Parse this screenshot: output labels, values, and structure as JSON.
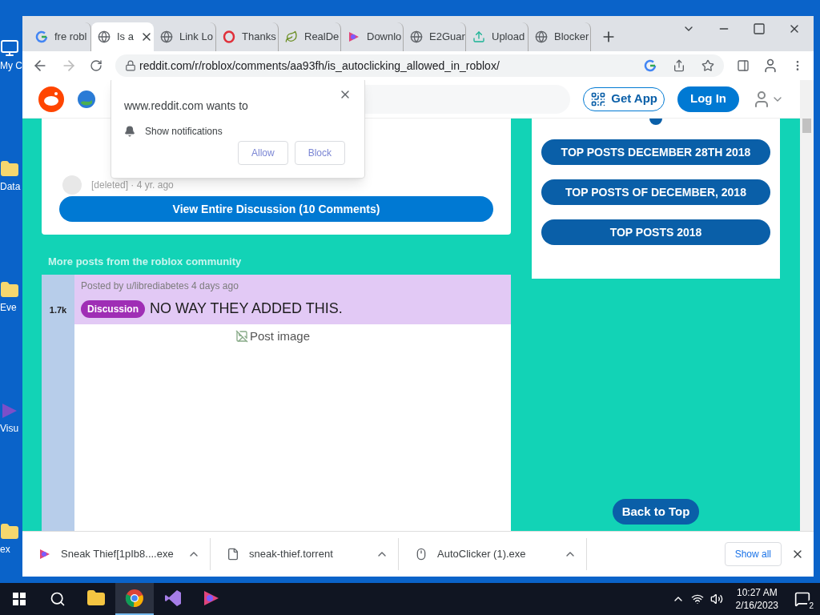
{
  "desktop_icons": [
    {
      "label": "My C",
      "kind": "pc"
    },
    {
      "label": "Data",
      "kind": "folder"
    },
    {
      "label": "Eve",
      "kind": "folder"
    },
    {
      "label": "Visu",
      "kind": "vs"
    },
    {
      "label": "ex",
      "kind": "folder"
    }
  ],
  "tabs": [
    {
      "title": "fre robl",
      "kind": "google",
      "selected": false
    },
    {
      "title": "Is a",
      "kind": "globe",
      "selected": true
    },
    {
      "title": "Link Lo",
      "kind": "globe",
      "selected": false
    },
    {
      "title": "Thanks",
      "kind": "opera",
      "selected": false
    },
    {
      "title": "RealDe",
      "kind": "leaf",
      "selected": false
    },
    {
      "title": "Downlo",
      "kind": "ds",
      "selected": false
    },
    {
      "title": "E2Guar",
      "kind": "globe",
      "selected": false
    },
    {
      "title": "Upload",
      "kind": "upload",
      "selected": false
    },
    {
      "title": "Blocker",
      "kind": "globe",
      "selected": false
    }
  ],
  "address_bar": {
    "url": "reddit.com/r/roblox/comments/aa93fh/is_autoclicking_allowed_in_roblox/"
  },
  "header": {
    "get_app": "Get App",
    "log_in": "Log In"
  },
  "comments": {
    "deleted_meta": "[deleted] · 4 yr. ago",
    "view_all": "View Entire Discussion (10 Comments)"
  },
  "more_posts": {
    "heading": "More posts from the roblox community",
    "post": {
      "votes": "1.7k",
      "meta": "Posted by u/librediabetes 4 days ago",
      "flair": "Discussion",
      "title": "NO WAY THEY ADDED THIS.",
      "image_alt": "Post image"
    }
  },
  "sidebar": {
    "links": [
      "TOP POSTS DECEMBER 28TH 2018",
      "TOP POSTS OF DECEMBER, 2018",
      "TOP POSTS 2018"
    ],
    "back_to_top": "Back to Top"
  },
  "popup": {
    "title": "www.reddit.com wants to",
    "permission": "Show notifications",
    "buttons": [
      "Allow",
      "Block"
    ]
  },
  "downloads": {
    "items": [
      {
        "name": "Sneak Thief[1pIb8....exe",
        "kind": "ds"
      },
      {
        "name": "sneak-thief.torrent",
        "kind": "file"
      },
      {
        "name": "AutoClicker (1).exe",
        "kind": "mouse"
      }
    ],
    "show_all": "Show all"
  },
  "taskbar": {
    "apps": [
      {
        "kind": "explorer",
        "selected": false
      },
      {
        "kind": "chrome",
        "selected": true
      },
      {
        "kind": "vs",
        "selected": false
      },
      {
        "kind": "ds",
        "selected": false
      }
    ],
    "time": "10:27 AM",
    "date": "2/16/2023",
    "notifications": "2"
  }
}
